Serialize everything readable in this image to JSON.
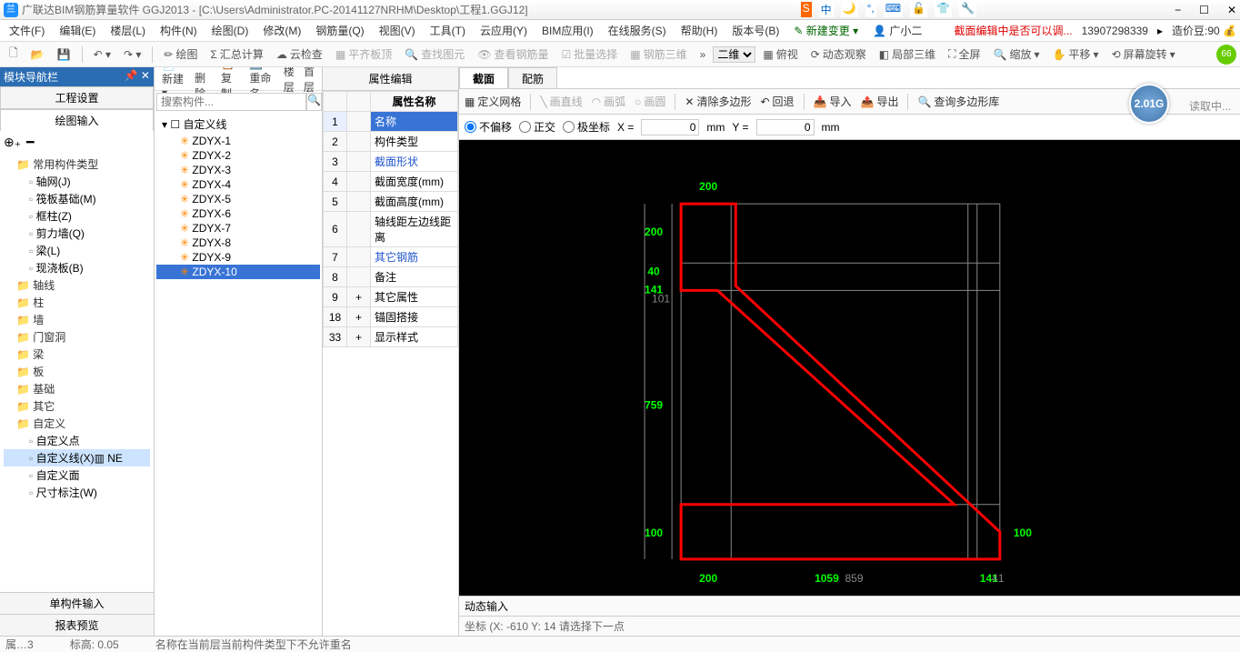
{
  "title": "广联达BIM钢筋算量软件 GGJ2013 - [C:\\Users\\Administrator.PC-20141127NRHM\\Desktop\\工程1.GGJ12]",
  "ime_icons": [
    "S",
    "中",
    "🌙",
    "°,",
    "⌨",
    "🔓",
    "👕",
    "🔧"
  ],
  "wincontrols": [
    "−",
    "☐",
    "✕"
  ],
  "menubar": [
    "文件(F)",
    "编辑(E)",
    "楼层(L)",
    "构件(N)",
    "绘图(D)",
    "修改(M)",
    "钢筋量(Q)",
    "视图(V)",
    "工具(T)",
    "云应用(Y)",
    "BIM应用(I)",
    "在线服务(S)",
    "帮助(H)",
    "版本号(B)"
  ],
  "menu_right": {
    "newchange": "新建变更",
    "user": "广小二",
    "notice": "截面编辑中是否可以调...",
    "phone": "13907298339",
    "coin_label": "造价豆:",
    "coin": "90"
  },
  "toolbar": [
    "绘图",
    "汇总计算",
    "云检查",
    "平齐板顶",
    "查找图元",
    "查看钢筋量",
    "批量选择",
    "钢筋三维"
  ],
  "toolbar_right": [
    "二维",
    "俯视",
    "动态观察",
    "局部三维",
    "全屏",
    "缩放",
    "平移",
    "屏幕旋转"
  ],
  "toolbar_badge": "66",
  "nav": {
    "header": "模块导航栏",
    "tabs": [
      "工程设置",
      "绘图输入"
    ],
    "active_tab": 1,
    "glyphs": [
      "⊕₊",
      "━"
    ]
  },
  "tree": [
    {
      "l": 0,
      "t": "常用构件类型",
      "fold": true,
      "open": true
    },
    {
      "l": 1,
      "t": "轴网(J)",
      "leaf": true
    },
    {
      "l": 1,
      "t": "筏板基础(M)",
      "leaf": true
    },
    {
      "l": 1,
      "t": "框柱(Z)",
      "leaf": true
    },
    {
      "l": 1,
      "t": "剪力墙(Q)",
      "leaf": true
    },
    {
      "l": 1,
      "t": "梁(L)",
      "leaf": true
    },
    {
      "l": 1,
      "t": "现浇板(B)",
      "leaf": true
    },
    {
      "l": 0,
      "t": "轴线",
      "fold": true
    },
    {
      "l": 0,
      "t": "柱",
      "fold": true
    },
    {
      "l": 0,
      "t": "墙",
      "fold": true
    },
    {
      "l": 0,
      "t": "门窗洞",
      "fold": true
    },
    {
      "l": 0,
      "t": "梁",
      "fold": true
    },
    {
      "l": 0,
      "t": "板",
      "fold": true
    },
    {
      "l": 0,
      "t": "基础",
      "fold": true
    },
    {
      "l": 0,
      "t": "其它",
      "fold": true
    },
    {
      "l": 0,
      "t": "自定义",
      "fold": true,
      "open": true
    },
    {
      "l": 1,
      "t": "自定义点",
      "leaf": true
    },
    {
      "l": 1,
      "t": "自定义线(X)▥ NE",
      "leaf": true,
      "sel": true
    },
    {
      "l": 1,
      "t": "自定义面",
      "leaf": true
    },
    {
      "l": 1,
      "t": "尺寸标注(W)",
      "leaf": true
    }
  ],
  "bottombtns": [
    "单构件输入",
    "报表预览"
  ],
  "midtb": [
    "新建",
    "删除",
    "复制",
    "重命名",
    "楼层",
    "首层"
  ],
  "search_placeholder": "搜索构件...",
  "complist": {
    "root": "自定义线",
    "items": [
      "ZDYX-1",
      "ZDYX-2",
      "ZDYX-3",
      "ZDYX-4",
      "ZDYX-5",
      "ZDYX-6",
      "ZDYX-7",
      "ZDYX-8",
      "ZDYX-9",
      "ZDYX-10"
    ],
    "selected": 9
  },
  "propheader": "属性编辑",
  "propcolhdr": "属性名称",
  "proprows": [
    {
      "n": "1",
      "v": "名称",
      "hl": true
    },
    {
      "n": "2",
      "v": "构件类型"
    },
    {
      "n": "3",
      "v": "截面形状",
      "blue": true
    },
    {
      "n": "4",
      "v": "截面宽度(mm)"
    },
    {
      "n": "5",
      "v": "截面高度(mm)"
    },
    {
      "n": "6",
      "v": "轴线距左边线距离"
    },
    {
      "n": "7",
      "v": "其它钢筋",
      "blue": true
    },
    {
      "n": "8",
      "v": "备注"
    },
    {
      "n": "9",
      "p": "+",
      "v": "其它属性"
    },
    {
      "n": "18",
      "p": "+",
      "v": "锚固搭接"
    },
    {
      "n": "33",
      "p": "+",
      "v": "显示样式"
    }
  ],
  "ctabs": [
    "截面",
    "配筋"
  ],
  "drawtb": [
    "定义网格",
    "画直线",
    "画弧",
    "画圆",
    "清除多边形",
    "回退",
    "导入",
    "导出",
    "查询多边形库"
  ],
  "coord": {
    "modes": [
      "不偏移",
      "正交",
      "极坐标"
    ],
    "selmode": 0,
    "X": "0",
    "Y": "0",
    "unit": "mm"
  },
  "canvas_dims": {
    "top": "200",
    "left_top": "200",
    "left_mid_40": "40",
    "left_mid_141": "141",
    "left_mid_101": "101",
    "left_7": "759",
    "left_bot": "100",
    "right_bot": "100",
    "bot_200": "200",
    "bot_center": "1059",
    "bot_859": "859",
    "bot_right": "141",
    "bot_right2": "41"
  },
  "cfooter": "动态输入",
  "cstatus": "坐标 (X: -610 Y: 14  请选择下一点",
  "badge": "2.01G",
  "reading": "读取中...",
  "status_left": "属…3",
  "status_mid": "标高: 0.05",
  "status_right": "名称在当前层当前构件类型下不允许重名"
}
